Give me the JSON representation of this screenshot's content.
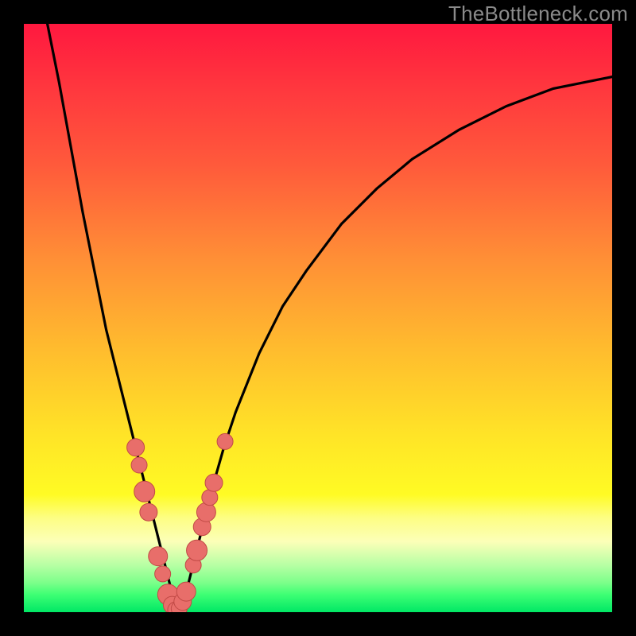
{
  "watermark": "TheBottleneck.com",
  "colors": {
    "bg": "#000000",
    "curve": "#000000",
    "dot_fill": "#e86e6a",
    "dot_stroke": "#c14a46"
  },
  "chart_data": {
    "type": "line",
    "title": "",
    "xlabel": "",
    "ylabel": "",
    "xlim": [
      0,
      100
    ],
    "ylim": [
      0,
      100
    ],
    "note": "Bottleneck-style V-curve. x is relative horizontal position (0–100), y is bottleneck percentage (0 = no bottleneck at valley). Two curve branches meet near x≈26.",
    "series": [
      {
        "name": "left-branch",
        "x": [
          4,
          6,
          8,
          10,
          12,
          14,
          16,
          18,
          19,
          20,
          21,
          22,
          23,
          24,
          25,
          25.5,
          26
        ],
        "values": [
          100,
          90,
          79,
          68,
          58,
          48,
          40,
          32,
          28,
          24,
          20,
          16,
          12,
          8,
          4,
          2,
          0
        ]
      },
      {
        "name": "right-branch",
        "x": [
          26,
          27,
          28,
          29,
          30,
          31,
          32,
          34,
          36,
          40,
          44,
          48,
          54,
          60,
          66,
          74,
          82,
          90,
          100
        ],
        "values": [
          0,
          2,
          5,
          9,
          13,
          17,
          21,
          28,
          34,
          44,
          52,
          58,
          66,
          72,
          77,
          82,
          86,
          89,
          91
        ]
      }
    ],
    "points": {
      "name": "highlighted-samples",
      "note": "Pink dots clustered around the valley on both branches.",
      "x": [
        19.0,
        19.6,
        20.5,
        21.2,
        22.8,
        23.6,
        24.5,
        25.2,
        25.8,
        26.4,
        27.0,
        27.6,
        28.8,
        29.4,
        30.3,
        31.0,
        31.6,
        32.3,
        34.2
      ],
      "values": [
        28.0,
        25.0,
        20.5,
        17.0,
        9.5,
        6.5,
        3.0,
        1.2,
        0.4,
        0.6,
        1.8,
        3.5,
        8.0,
        10.5,
        14.5,
        17.0,
        19.5,
        22.0,
        29.0
      ],
      "radius": [
        11,
        10,
        13,
        11,
        12,
        10,
        13,
        11,
        10,
        10,
        11,
        12,
        10,
        13,
        11,
        12,
        10,
        11,
        10
      ]
    }
  }
}
